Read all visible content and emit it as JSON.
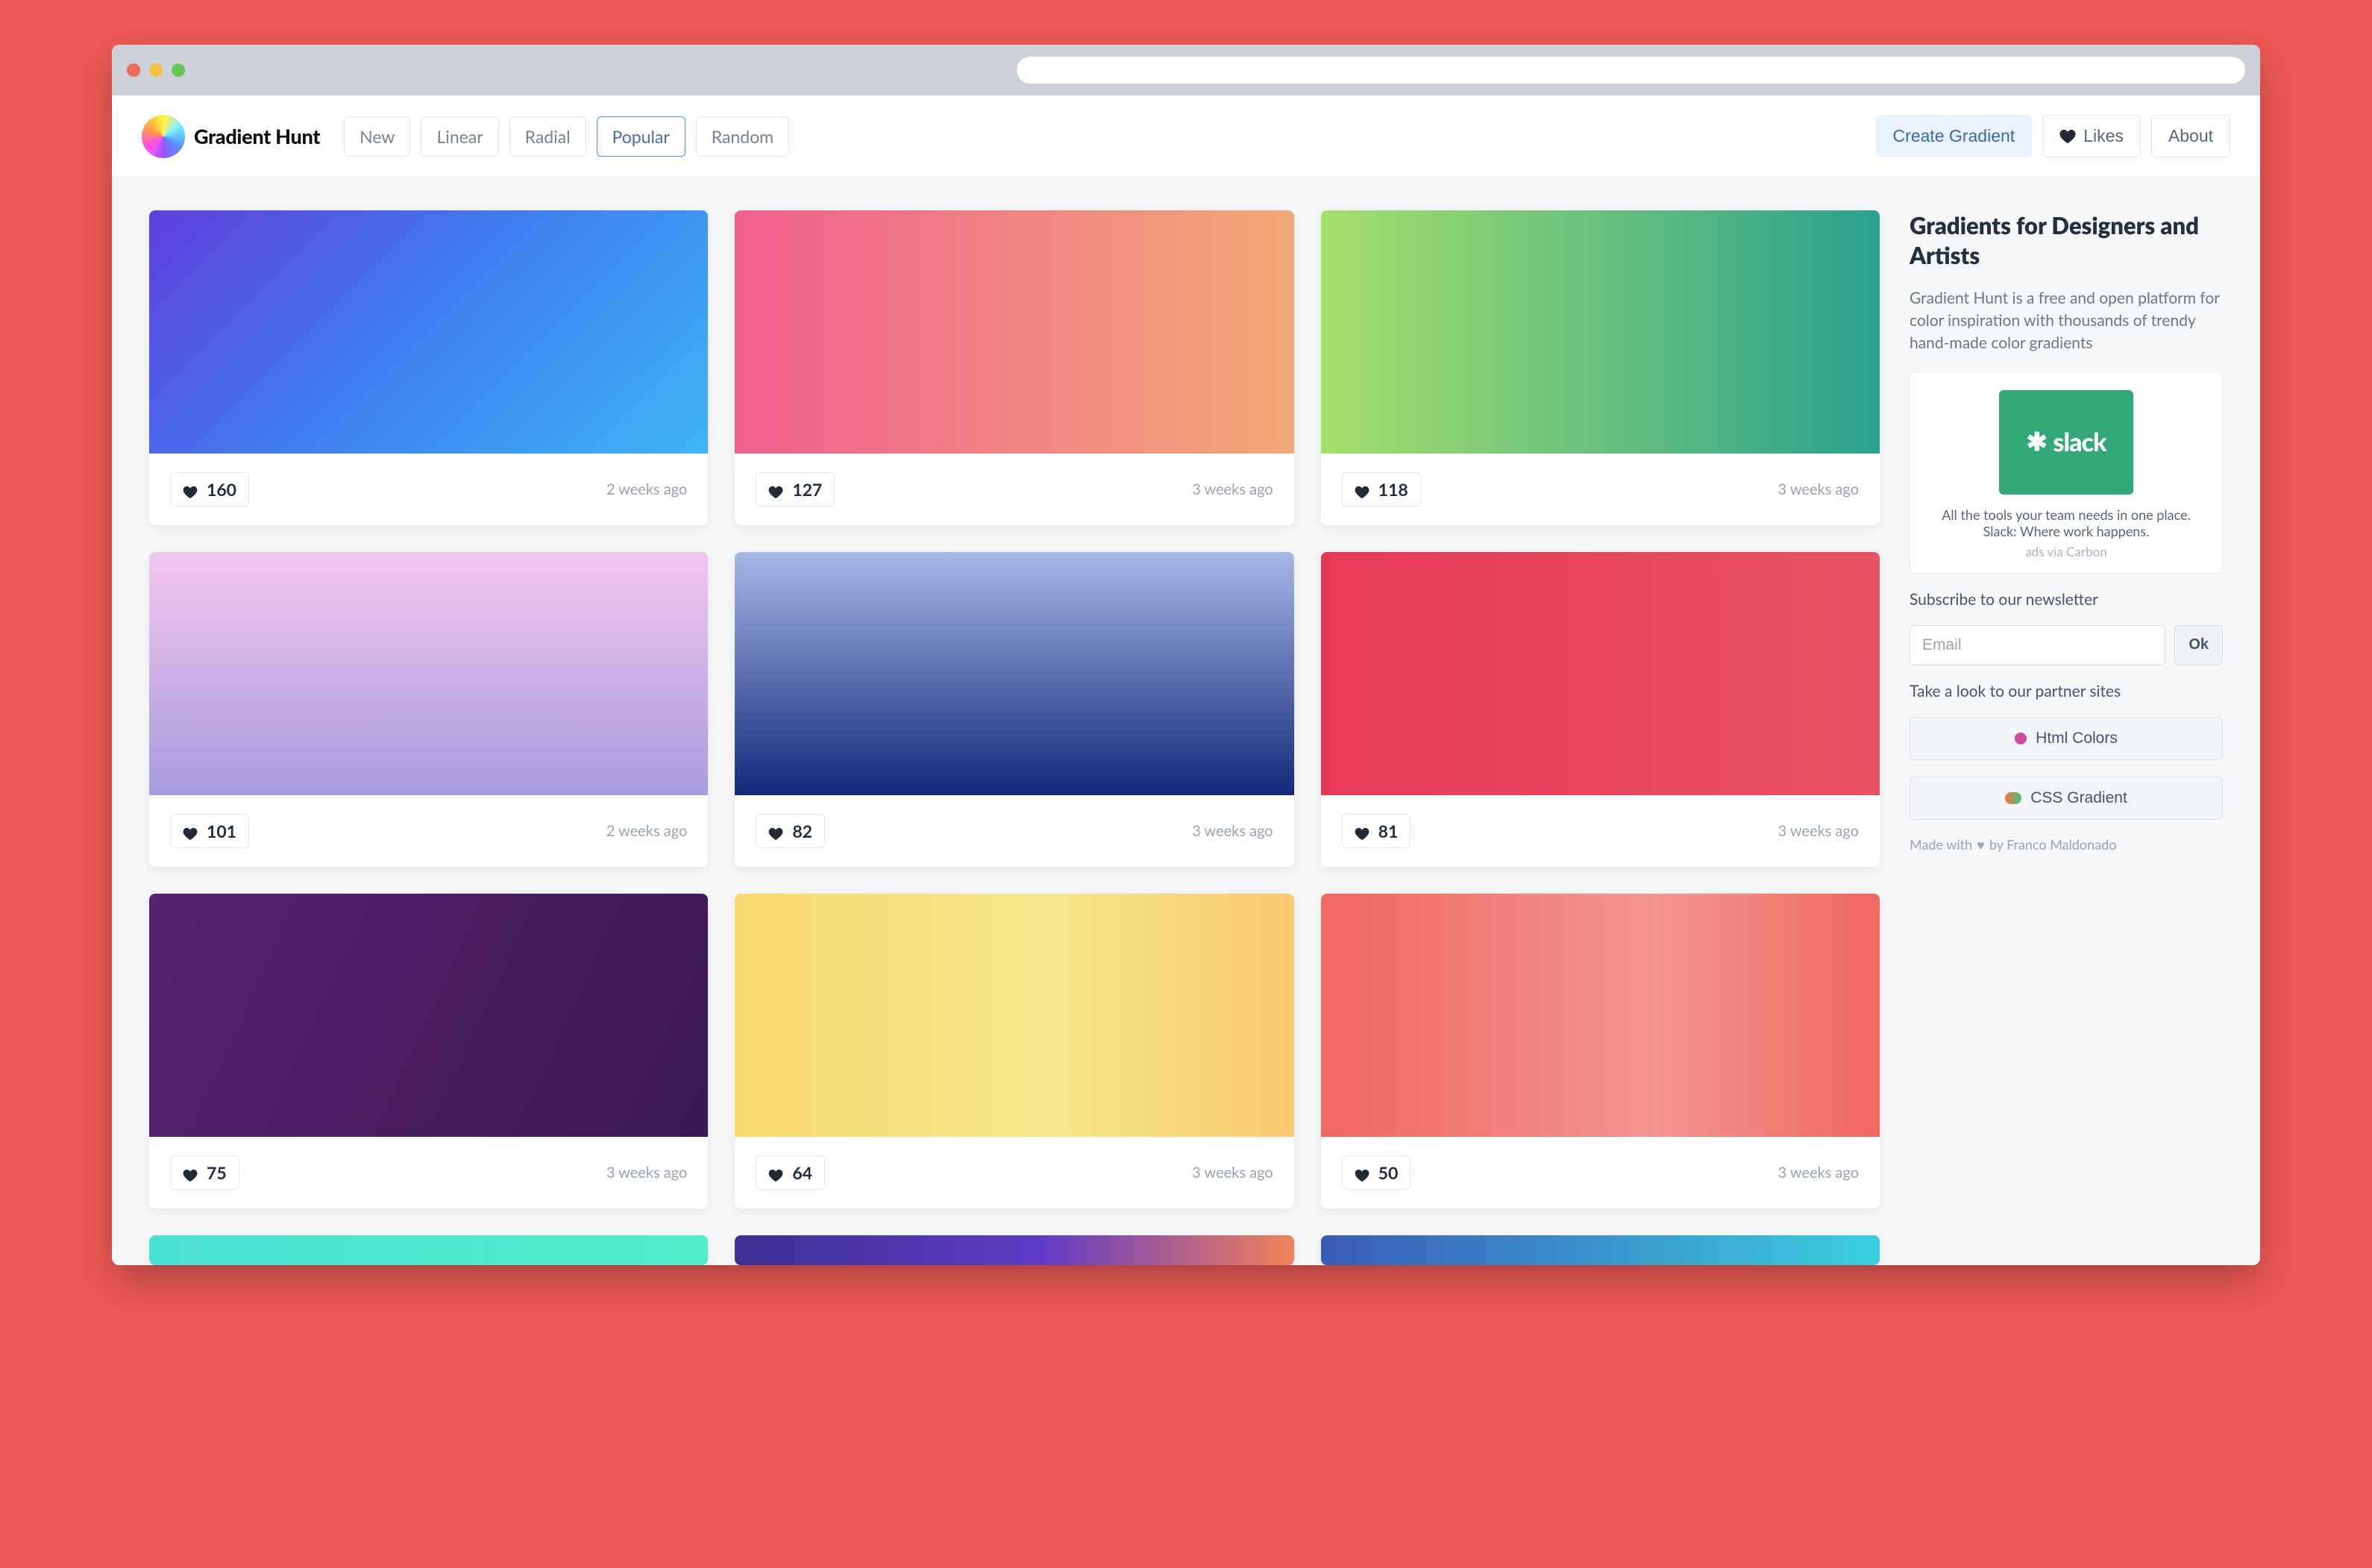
{
  "brand": {
    "name": "Gradient Hunt"
  },
  "nav": {
    "tabs": [
      {
        "label": "New",
        "active": false
      },
      {
        "label": "Linear",
        "active": false
      },
      {
        "label": "Radial",
        "active": false
      },
      {
        "label": "Popular",
        "active": true
      },
      {
        "label": "Random",
        "active": false
      }
    ],
    "create_label": "Create Gradient",
    "likes_label": "Likes",
    "about_label": "About"
  },
  "gradients": [
    {
      "likes": "160",
      "age": "2 weeks ago",
      "css": "linear-gradient(135deg,#5f3fdb 0%,#3f7ff0 48%,#3eb5f6 100%)"
    },
    {
      "likes": "127",
      "age": "3 weeks ago",
      "css": "linear-gradient(90deg,#f15f8f 0%,#f2a976 100%)"
    },
    {
      "likes": "118",
      "age": "3 weeks ago",
      "css": "linear-gradient(90deg,#a5e06b 0%,#2aa18f 100%)"
    },
    {
      "likes": "101",
      "age": "2 weeks ago",
      "css": "linear-gradient(180deg,#f2c7ee 0%,#a89bdc 100%)"
    },
    {
      "likes": "82",
      "age": "3 weeks ago",
      "css": "linear-gradient(180deg,#a7b7e6 0%,#122a7a 100%)"
    },
    {
      "likes": "81",
      "age": "3 weeks ago",
      "css": "linear-gradient(90deg,#e63956 0%,#e85364 100%)"
    },
    {
      "likes": "75",
      "age": "3 weeks ago",
      "css": "linear-gradient(115deg,#5a2370 0%,#3a1852 100%)"
    },
    {
      "likes": "64",
      "age": "3 weeks ago",
      "css": "linear-gradient(90deg,#f7d96e 0%,#f6e88d 55%,#f7c96e 100%)"
    },
    {
      "likes": "50",
      "age": "3 weeks ago",
      "css": "linear-gradient(90deg,#f0675d 0%,#f2968f 60%,#f0675d 100%)"
    },
    {
      "likes": "",
      "age": "",
      "css": "linear-gradient(90deg,#4be0d4 0%,#51efc9 100%)"
    },
    {
      "likes": "",
      "age": "",
      "css": "linear-gradient(90deg,#3d2f93 0%,#5f3cc6 55%,#f1825b 100%)"
    },
    {
      "likes": "",
      "age": "",
      "css": "linear-gradient(90deg,#3a5bb7 0%,#3acfe0 100%)"
    }
  ],
  "sidebar": {
    "title": "Gradients for Designers and Artists",
    "desc": "Gradient Hunt is a free and open platform for color inspiration with thousands of trendy hand-made color gradients",
    "ad": {
      "brand": "slack",
      "text": "All the tools your team needs in one place. Slack: Where work happens.",
      "via": "ads via Carbon"
    },
    "sub_label": "Subscribe to our newsletter",
    "email_placeholder": "Email",
    "ok_label": "Ok",
    "partner_label": "Take a look to our partner sites",
    "partner1": "Html Colors",
    "partner2": "CSS Gradient",
    "credit_prefix": "Made with",
    "credit_suffix": "by Franco Maldonado"
  },
  "colors": {
    "tl_red": "#ec6a5e",
    "tl_yellow": "#f5c042",
    "tl_green": "#62c755"
  }
}
